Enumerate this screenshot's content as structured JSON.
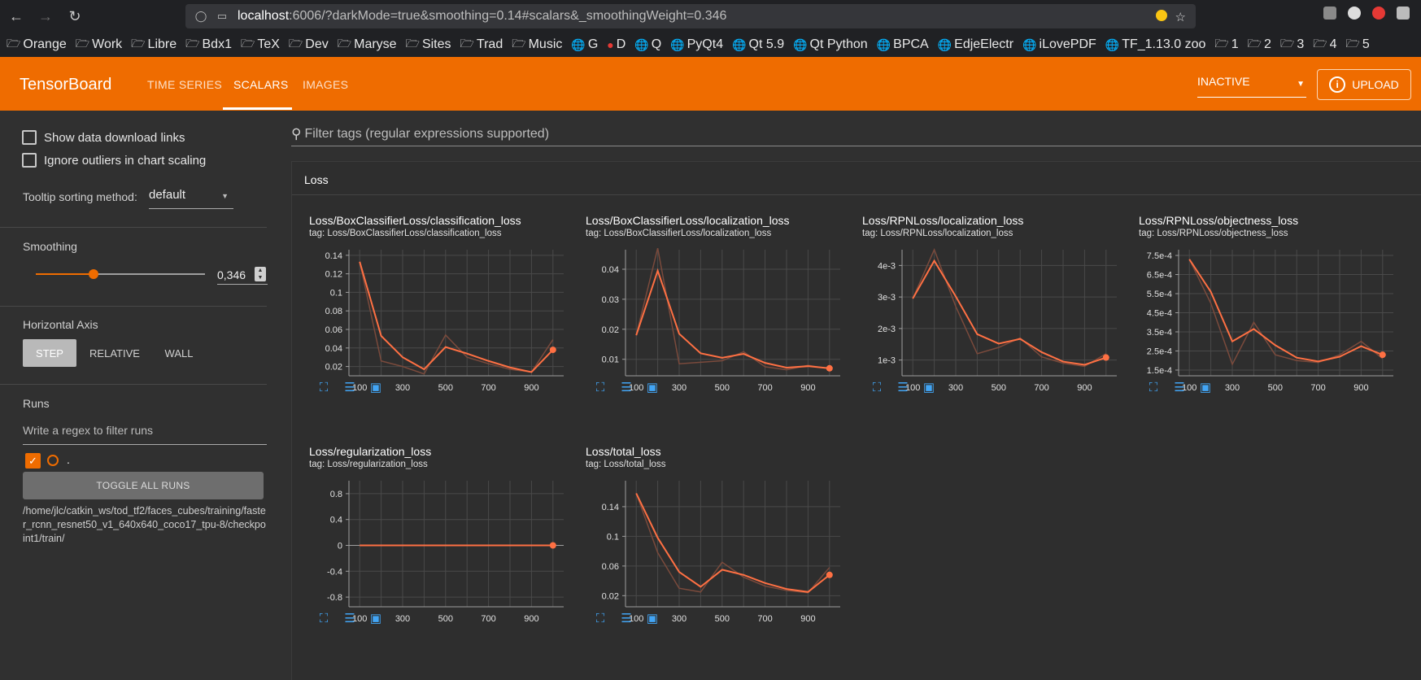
{
  "browser": {
    "url_host": "localhost",
    "url_rest": ":6006/?darkMode=true&smoothing=0.14#scalars&_smoothingWeight=0.346",
    "bookmarks": [
      "Orange",
      "Work",
      "Libre",
      "Bdx1",
      "TeX",
      "Dev",
      "Maryse",
      "Sites",
      "Trad",
      "Music",
      "G",
      "D",
      "Q",
      "PyQt4",
      "Qt 5.9",
      "Qt Python",
      "BPCA",
      "EdjeElectr",
      "iLovePDF",
      "TF_1.13.0 zoo",
      "1",
      "2",
      "3",
      "4",
      "5"
    ]
  },
  "header": {
    "brand": "TensorBoard",
    "tabs": [
      "TIME SERIES",
      "SCALARS",
      "IMAGES"
    ],
    "active_tab": "SCALARS",
    "status_select": "INACTIVE",
    "upload_label": "UPLOAD"
  },
  "sidebar": {
    "show_download": "Show data download links",
    "ignore_outliers": "Ignore outliers in chart scaling",
    "tooltip_label": "Tooltip sorting method:",
    "tooltip_value": "default",
    "smoothing_label": "Smoothing",
    "smoothing_value": "0,346",
    "smoothing_fraction": 0.346,
    "horizontal_axis_label": "Horizontal Axis",
    "axis_options": [
      "STEP",
      "RELATIVE",
      "WALL"
    ],
    "axis_selected": "STEP",
    "runs_label": "Runs",
    "runs_filter_placeholder": "Write a regex to filter runs",
    "run_name": ".",
    "toggle_all": "TOGGLE ALL RUNS",
    "run_path": "/home/jlc/catkin_ws/tod_tf2/faces_cubes/training/faster_rcnn_resnet50_v1_640x640_coco17_tpu-8/checkpoint1/train/"
  },
  "main": {
    "filter_placeholder": "Filter tags (regular expressions supported)",
    "group_title": "Loss"
  },
  "colors": {
    "accent": "#ef6c00",
    "line": "#ff7043",
    "raw_line": "#7a4a3c",
    "icon_blue": "#42a5f5"
  },
  "chart_data": [
    {
      "type": "line",
      "title": "Loss/BoxClassifierLoss/classification_loss",
      "tag": "tag: Loss/BoxClassifierLoss/classification_loss",
      "x": [
        100,
        200,
        300,
        400,
        500,
        600,
        700,
        800,
        900,
        1000
      ],
      "series": [
        {
          "values": [
            0.133,
            0.053,
            0.03,
            0.017,
            0.041,
            0.034,
            0.026,
            0.019,
            0.014,
            0.038
          ]
        },
        {
          "values": [
            0.133,
            0.026,
            0.02,
            0.012,
            0.054,
            0.03,
            0.023,
            0.017,
            0.014,
            0.049
          ]
        }
      ],
      "xticks": [
        "100",
        "300",
        "500",
        "700",
        "900"
      ],
      "yticks": [
        0.02,
        0.04,
        0.06,
        0.08,
        0.1,
        0.12,
        0.14
      ],
      "ytick_labels": [
        "0.02",
        "0.04",
        "0.06",
        "0.08",
        "0.1",
        "0.12",
        "0.14"
      ],
      "ylim": [
        0.01,
        0.146
      ]
    },
    {
      "type": "line",
      "title": "Loss/BoxClassifierLoss/localization_loss",
      "tag": "tag: Loss/BoxClassifierLoss/localization_loss",
      "x": [
        100,
        200,
        300,
        400,
        500,
        600,
        700,
        800,
        900,
        1000
      ],
      "series": [
        {
          "values": [
            0.018,
            0.0395,
            0.0185,
            0.012,
            0.0105,
            0.0118,
            0.0088,
            0.0072,
            0.0077,
            0.007
          ]
        },
        {
          "values": [
            0.018,
            0.047,
            0.0085,
            0.009,
            0.0095,
            0.0125,
            0.0075,
            0.0065,
            0.008,
            0.0068
          ]
        }
      ],
      "xticks": [
        "100",
        "300",
        "500",
        "700",
        "900"
      ],
      "yticks": [
        0.01,
        0.02,
        0.03,
        0.04
      ],
      "ytick_labels": [
        "0.01",
        "0.02",
        "0.03",
        "0.04"
      ],
      "ylim": [
        0.0045,
        0.0465
      ]
    },
    {
      "type": "line",
      "title": "Loss/RPNLoss/localization_loss",
      "tag": "tag: Loss/RPNLoss/localization_loss",
      "x": [
        100,
        200,
        300,
        400,
        500,
        600,
        700,
        800,
        900,
        1000
      ],
      "series": [
        {
          "values": [
            0.00295,
            0.00415,
            0.00302,
            0.00182,
            0.00152,
            0.00167,
            0.00125,
            0.00095,
            0.00085,
            0.00108
          ]
        },
        {
          "values": [
            0.00295,
            0.0045,
            0.0027,
            0.0012,
            0.0014,
            0.0017,
            0.0011,
            0.0009,
            0.0008,
            0.0012
          ]
        }
      ],
      "xticks": [
        "100",
        "300",
        "500",
        "700",
        "900"
      ],
      "yticks": [
        0.001,
        0.002,
        0.003,
        0.004
      ],
      "ytick_labels": [
        "1e-3",
        "2e-3",
        "3e-3",
        "4e-3"
      ],
      "ylim": [
        0.0005,
        0.0045
      ]
    },
    {
      "type": "line",
      "title": "Loss/RPNLoss/objectness_loss",
      "tag": "tag: Loss/RPNLoss/objectness_loss",
      "x": [
        100,
        200,
        300,
        400,
        500,
        600,
        700,
        800,
        900,
        1000
      ],
      "series": [
        {
          "values": [
            0.00073,
            0.00056,
            0.0003,
            0.000365,
            0.00028,
            0.000215,
            0.000195,
            0.00022,
            0.000275,
            0.00023
          ]
        },
        {
          "values": [
            0.00073,
            0.0005,
            0.00018,
            0.0004,
            0.00023,
            0.0002,
            0.00019,
            0.00023,
            0.0003,
            0.00021
          ]
        }
      ],
      "xticks": [
        "100",
        "300",
        "500",
        "700",
        "900"
      ],
      "yticks": [
        0.00015,
        0.00025,
        0.00035,
        0.00045,
        0.00055,
        0.00065,
        0.00075
      ],
      "ytick_labels": [
        "1.5e-4",
        "2.5e-4",
        "3.5e-4",
        "4.5e-4",
        "5.5e-4",
        "6.5e-4",
        "7.5e-4"
      ],
      "ylim": [
        0.00012,
        0.00078
      ]
    },
    {
      "type": "line",
      "title": "Loss/regularization_loss",
      "tag": "tag: Loss/regularization_loss",
      "x": [
        100,
        200,
        300,
        400,
        500,
        600,
        700,
        800,
        900,
        1000
      ],
      "series": [
        {
          "values": [
            0,
            0,
            0,
            0,
            0,
            0,
            0,
            0,
            0,
            0
          ]
        },
        {
          "values": [
            0,
            0,
            0,
            0,
            0,
            0,
            0,
            0,
            0,
            0
          ]
        }
      ],
      "xticks": [
        "100",
        "300",
        "500",
        "700",
        "900"
      ],
      "yticks": [
        -0.8,
        -0.4,
        0,
        0.4,
        0.8
      ],
      "ytick_labels": [
        "-0.8",
        "-0.4",
        "0",
        "0.4",
        "0.8"
      ],
      "ylim": [
        -0.95,
        1.0
      ]
    },
    {
      "type": "line",
      "title": "Loss/total_loss",
      "tag": "tag: Loss/total_loss",
      "x": [
        100,
        200,
        300,
        400,
        500,
        600,
        700,
        800,
        900,
        1000
      ],
      "series": [
        {
          "values": [
            0.158,
            0.098,
            0.052,
            0.032,
            0.055,
            0.048,
            0.037,
            0.029,
            0.025,
            0.048
          ]
        },
        {
          "values": [
            0.158,
            0.078,
            0.03,
            0.025,
            0.065,
            0.045,
            0.033,
            0.027,
            0.024,
            0.058
          ]
        }
      ],
      "xticks": [
        "100",
        "300",
        "500",
        "700",
        "900"
      ],
      "yticks": [
        0.02,
        0.06,
        0.1,
        0.14
      ],
      "ytick_labels": [
        "0.02",
        "0.06",
        "0.1",
        "0.14"
      ],
      "ylim": [
        0.005,
        0.175
      ]
    }
  ]
}
